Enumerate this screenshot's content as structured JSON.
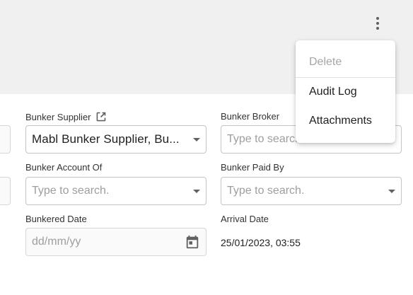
{
  "header": {
    "more_icon": "more-vert-icon"
  },
  "form": {
    "bunker_supplier": {
      "label": "Bunker Supplier",
      "link_icon": "open-in-new-icon",
      "value": "Mabl Bunker Supplier, Bu..."
    },
    "bunker_broker": {
      "label": "Bunker Broker",
      "placeholder": "Type to search."
    },
    "bunker_account_of": {
      "label": "Bunker Account Of",
      "placeholder": "Type to search."
    },
    "bunker_paid_by": {
      "label": "Bunker Paid By",
      "placeholder": "Type to search."
    },
    "bunkered_date": {
      "label": "Bunkered Date",
      "placeholder": "dd/mm/yy",
      "icon": "calendar-icon"
    },
    "arrival_date": {
      "label": "Arrival Date",
      "value": "25/01/2023, 03:55"
    }
  },
  "menu": {
    "items": [
      {
        "label": "Delete",
        "disabled": true
      },
      {
        "label": "Audit Log",
        "disabled": false
      },
      {
        "label": "Attachments",
        "disabled": false
      }
    ]
  }
}
